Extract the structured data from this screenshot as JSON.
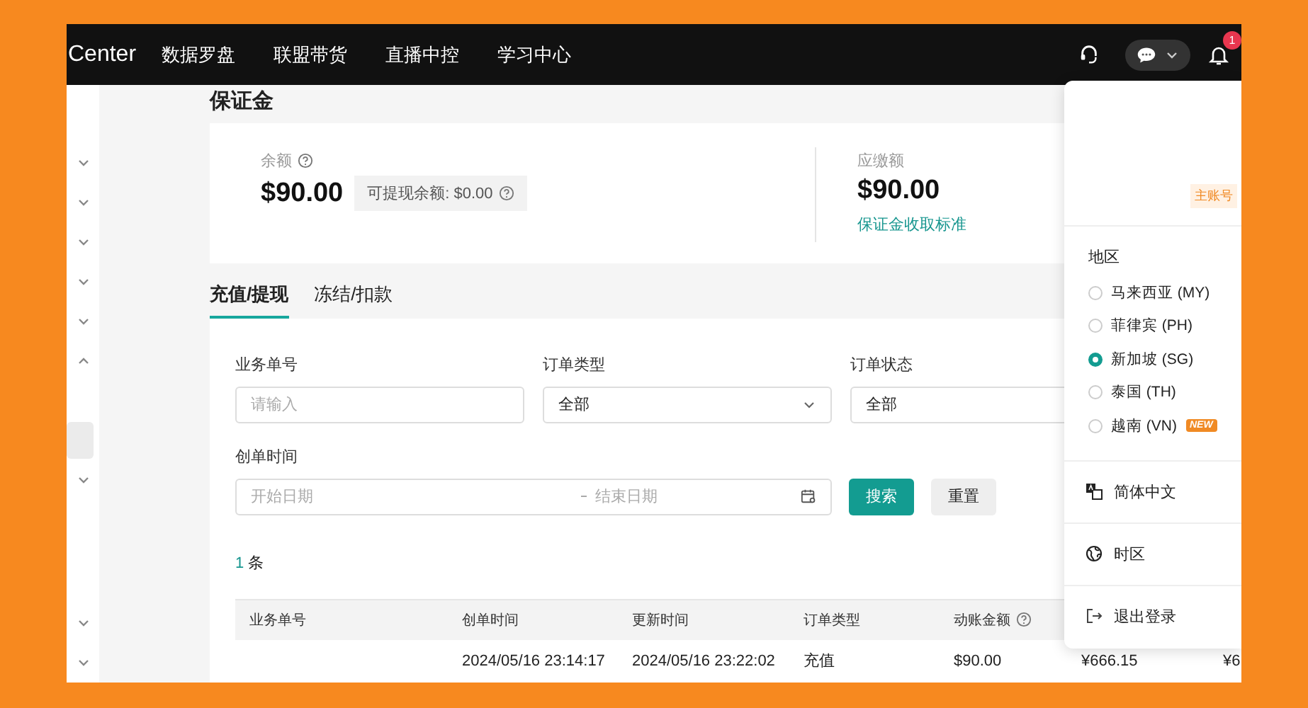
{
  "nav": {
    "brand": "Center",
    "menu": [
      "数据罗盘",
      "联盟带货",
      "直播中控",
      "学习中心"
    ],
    "notification_badge": "1"
  },
  "sidebar": {
    "items": [
      {
        "kind": "group",
        "expanded": false
      },
      {
        "kind": "group",
        "expanded": false
      },
      {
        "kind": "group",
        "expanded": false
      },
      {
        "kind": "group",
        "expanded": false
      },
      {
        "kind": "group",
        "expanded": false
      },
      {
        "kind": "group",
        "expanded": true
      },
      {
        "kind": "link",
        "selected": true
      },
      {
        "kind": "group",
        "expanded": false
      }
    ],
    "bottom_items": [
      {
        "kind": "group",
        "expanded": false
      },
      {
        "kind": "group",
        "expanded": false
      }
    ]
  },
  "page_title": "保证金",
  "summary": {
    "balance": {
      "label": "余额",
      "amount": "$90.00",
      "withdrawable": "可提现余额: $0.00"
    },
    "due": {
      "label": "应缴额",
      "amount": "$90.00",
      "link": "保证金收取标准"
    }
  },
  "tabs": [
    {
      "label": "充值/提现",
      "selected": true
    },
    {
      "label": "冻结/扣款",
      "selected": false
    }
  ],
  "filters": {
    "fields": [
      {
        "kind": "input",
        "label": "业务单号",
        "placeholder": "请输入"
      },
      {
        "kind": "select",
        "label": "订单类型",
        "value": "全部"
      },
      {
        "kind": "select",
        "label": "订单状态",
        "value": "全部"
      }
    ],
    "date_range": {
      "label": "创单时间",
      "start_placeholder": "开始日期",
      "end_placeholder": "结束日期"
    },
    "search_button": "搜索",
    "reset_button": "重置"
  },
  "result_count": {
    "number": "1",
    "unit": "条"
  },
  "table": {
    "columns": [
      "业务单号",
      "创单时间",
      "更新时间",
      "订单类型",
      "动账金额"
    ],
    "rows": [
      {
        "created": "2024/05/16 23:14:17",
        "updated": "2024/05/16 23:22:02",
        "type": "充值",
        "amount": "$90.00",
        "column_6": "¥666.15",
        "column_7": "¥6"
      }
    ]
  },
  "account_menu": {
    "account_tag": "主账号",
    "region_label": "地区",
    "regions": [
      {
        "label": "马来西亚 (MY)",
        "selected": false
      },
      {
        "label": "菲律宾 (PH)",
        "selected": false
      },
      {
        "label": "新加坡 (SG)",
        "selected": true
      },
      {
        "label": "泰国 (TH)",
        "selected": false
      },
      {
        "label": "越南 (VN)",
        "selected": false,
        "badge": "NEW"
      }
    ],
    "actions": [
      {
        "kind": "language",
        "label": "简体中文"
      },
      {
        "kind": "timezone",
        "label": "时区"
      },
      {
        "kind": "logout",
        "label": "退出登录"
      }
    ]
  }
}
